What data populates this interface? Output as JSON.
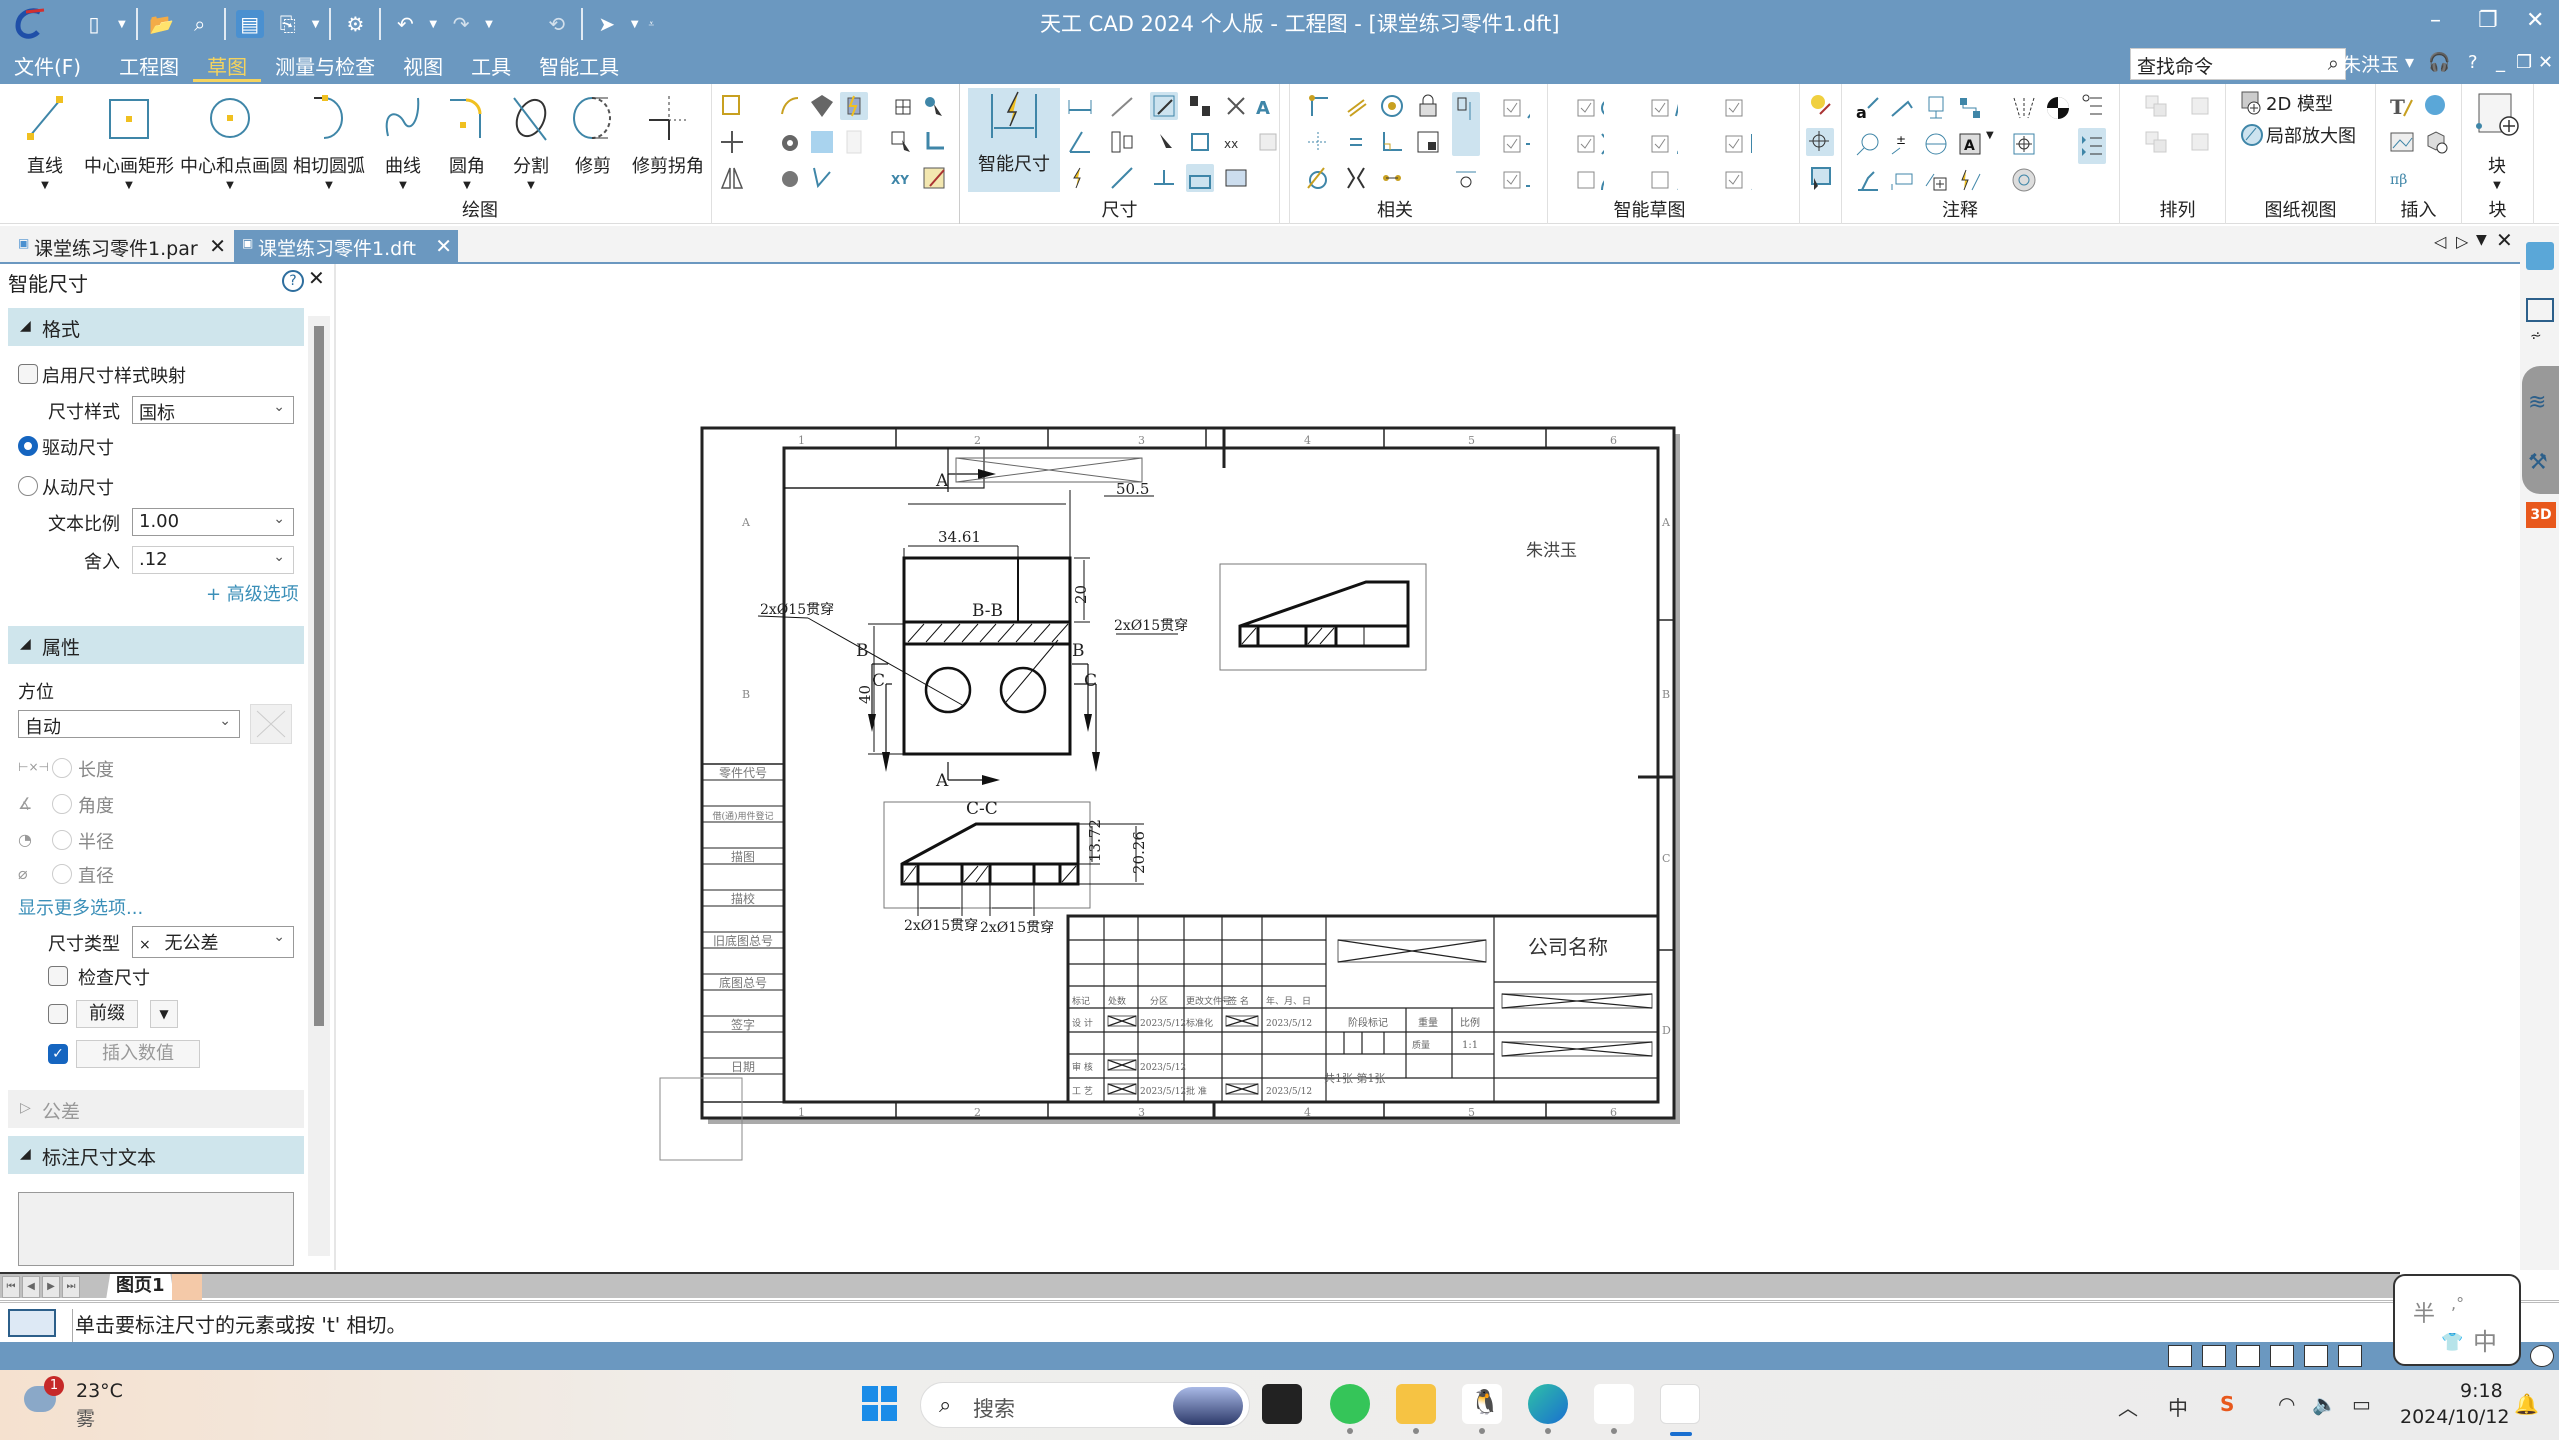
{
  "window": {
    "title": "天工 CAD 2024 个人版 - 工程图 - [课堂练习零件1.dft]",
    "minimize": "–",
    "restore": "❐",
    "close": "✕"
  },
  "quick_access": {
    "icons": [
      "new-file-icon",
      "open-file-icon",
      "find-icon",
      "save-icon",
      "save-as-icon",
      "settings-icon",
      "undo-icon",
      "redo-icon",
      "reapply-icon",
      "select-icon",
      "customize-icon"
    ]
  },
  "menu": {
    "tabs": [
      {
        "label": "文件(F)",
        "active": false
      },
      {
        "label": "工程图",
        "active": false
      },
      {
        "label": "草图",
        "active": true
      },
      {
        "label": "测量与检查",
        "active": false
      },
      {
        "label": "视图",
        "active": false
      },
      {
        "label": "工具",
        "active": false
      },
      {
        "label": "智能工具",
        "active": false
      }
    ],
    "search_placeholder": "查找命令",
    "user": "朱洪玉",
    "user_dropdown": "▾",
    "help": "?",
    "doc_min": "_",
    "doc_restore": "❐",
    "doc_close": "✕"
  },
  "ribbon": {
    "draw_group": {
      "label": "绘图",
      "buttons": [
        {
          "label": "直线",
          "dropdown": true
        },
        {
          "label": "中心画矩形",
          "dropdown": true
        },
        {
          "label": "中心和点画圆",
          "dropdown": true
        },
        {
          "label": "相切圆弧",
          "dropdown": true
        },
        {
          "label": "曲线",
          "dropdown": true
        },
        {
          "label": "圆角",
          "dropdown": true
        },
        {
          "label": "分割",
          "dropdown": true
        },
        {
          "label": "修剪",
          "dropdown": false
        },
        {
          "label": "修剪拐角",
          "dropdown": false
        }
      ]
    },
    "dimension_group": {
      "label": "尺寸",
      "big_button": "智能尺寸"
    },
    "relate_group": {
      "label": "相关"
    },
    "smart_sketch_group": {
      "label": "智能草图"
    },
    "annotation_group": {
      "label": "注释"
    },
    "arrange_group": {
      "label": "排列"
    },
    "drawing_view_group": {
      "label": "图纸视图",
      "buttons": [
        "2D 模型",
        "局部放大图"
      ]
    },
    "insert_group": {
      "label": "插入"
    },
    "block_group": {
      "label": "块",
      "big_button": "块"
    },
    "dropdown_arrow": "▾"
  },
  "doc_tabs": [
    {
      "label": "课堂练习零件1.par",
      "active": false
    },
    {
      "label": "课堂练习零件1.dft",
      "active": true
    }
  ],
  "doc_tab_controls": {
    "prev": "◁",
    "next": "▷",
    "menu": "▼",
    "close": "✕"
  },
  "panel": {
    "title": "智能尺寸",
    "help": "?",
    "close": "✕",
    "format_section": {
      "title": "格式",
      "enable_style_mapping": {
        "label": "启用尺寸样式映射",
        "checked": false
      },
      "dim_style": {
        "label": "尺寸样式",
        "value": "国标"
      },
      "driving": {
        "label": "驱动尺寸",
        "selected": true
      },
      "driven": {
        "label": "从动尺寸",
        "selected": false
      },
      "text_scale": {
        "label": "文本比例",
        "value": "1.00"
      },
      "rounding": {
        "label": "舍入",
        "value": ".12"
      },
      "advanced": "+ 高级选项"
    },
    "properties_section": {
      "title": "属性",
      "orientation_label": "方位",
      "orientation_value": "自动",
      "measure_options": [
        {
          "label": "长度",
          "icon": "length-dim-icon"
        },
        {
          "label": "角度",
          "icon": "angle-dim-icon"
        },
        {
          "label": "半径",
          "icon": "radius-dim-icon"
        },
        {
          "label": "直径",
          "icon": "diameter-dim-icon"
        }
      ],
      "more_options": "显示更多选项...",
      "dim_type": {
        "label": "尺寸类型",
        "value": "无公差",
        "prefix": "×"
      },
      "check_dim": {
        "label": "检查尺寸",
        "checked": false
      },
      "prefix": {
        "label": "前缀",
        "checked": false
      },
      "insert_value": {
        "label": "插入数值",
        "checked": true
      }
    },
    "tolerance_section": {
      "title": "公差"
    },
    "dim_text_section": {
      "title": "标注尺寸文本"
    }
  },
  "drawing": {
    "zone_columns": [
      "1",
      "2",
      "3",
      "4",
      "5",
      "6"
    ],
    "zone_rows": [
      "A",
      "B",
      "C",
      "D"
    ],
    "owner_text": "朱洪玉",
    "section_labels": {
      "bb": "B-B",
      "cc": "C-C"
    },
    "cut_labels": {
      "a": "A",
      "b": "B",
      "c": "C"
    },
    "dimensions": {
      "d_50_5": "50.5",
      "d_34_61": "34.61",
      "d_20": "20",
      "d_40": "40",
      "d_13_72": "13.72",
      "d_20_26": "20.26"
    },
    "callouts": {
      "hole": "2xØ15贯穿"
    },
    "side_table": [
      "零件代号",
      "借(通)用件登记",
      "描图",
      "描校",
      "旧底图总号",
      "底图总号",
      "签字",
      "日期"
    ],
    "title_block": {
      "headers": [
        "标记",
        "处数",
        "分区",
        "更改文件号",
        "签 名",
        "年、月、日"
      ],
      "rows": [
        {
          "role": "设 计",
          "date": "2023/5/12",
          "role2": "标准化",
          "date2": "2023/5/12"
        },
        {
          "role": "审 核",
          "date": "2023/5/12",
          "role2": "",
          "date2": ""
        },
        {
          "role": "工 艺",
          "date": "2023/5/12",
          "role2": "批 准",
          "date2": "2023/5/12"
        }
      ],
      "stage_mark": "阶段标记",
      "weight": "重量",
      "scale_label": "比例",
      "weight_value": "质量",
      "scale_value": "1:1",
      "sheet_info": "共1张   第1张",
      "company": "公司名称"
    }
  },
  "page_tabs": {
    "current": "图页1"
  },
  "command_prompt": "单击要标注尺寸的元素或按 't' 相切。",
  "ime": {
    "half": "半",
    "punct": ",°",
    "lang": "中"
  },
  "taskbar": {
    "weather_temp": "23°C",
    "weather_cond": "雾",
    "weather_badge": "1",
    "search_label": "搜索",
    "tray_lang": "中",
    "time": "9:18",
    "date": "2024/10/12"
  },
  "colors": {
    "titlebar": "#6b98c0",
    "accent_tab": "#f4d35e",
    "section_head": "#cfe5ec",
    "check_blue": "#1565c0"
  }
}
